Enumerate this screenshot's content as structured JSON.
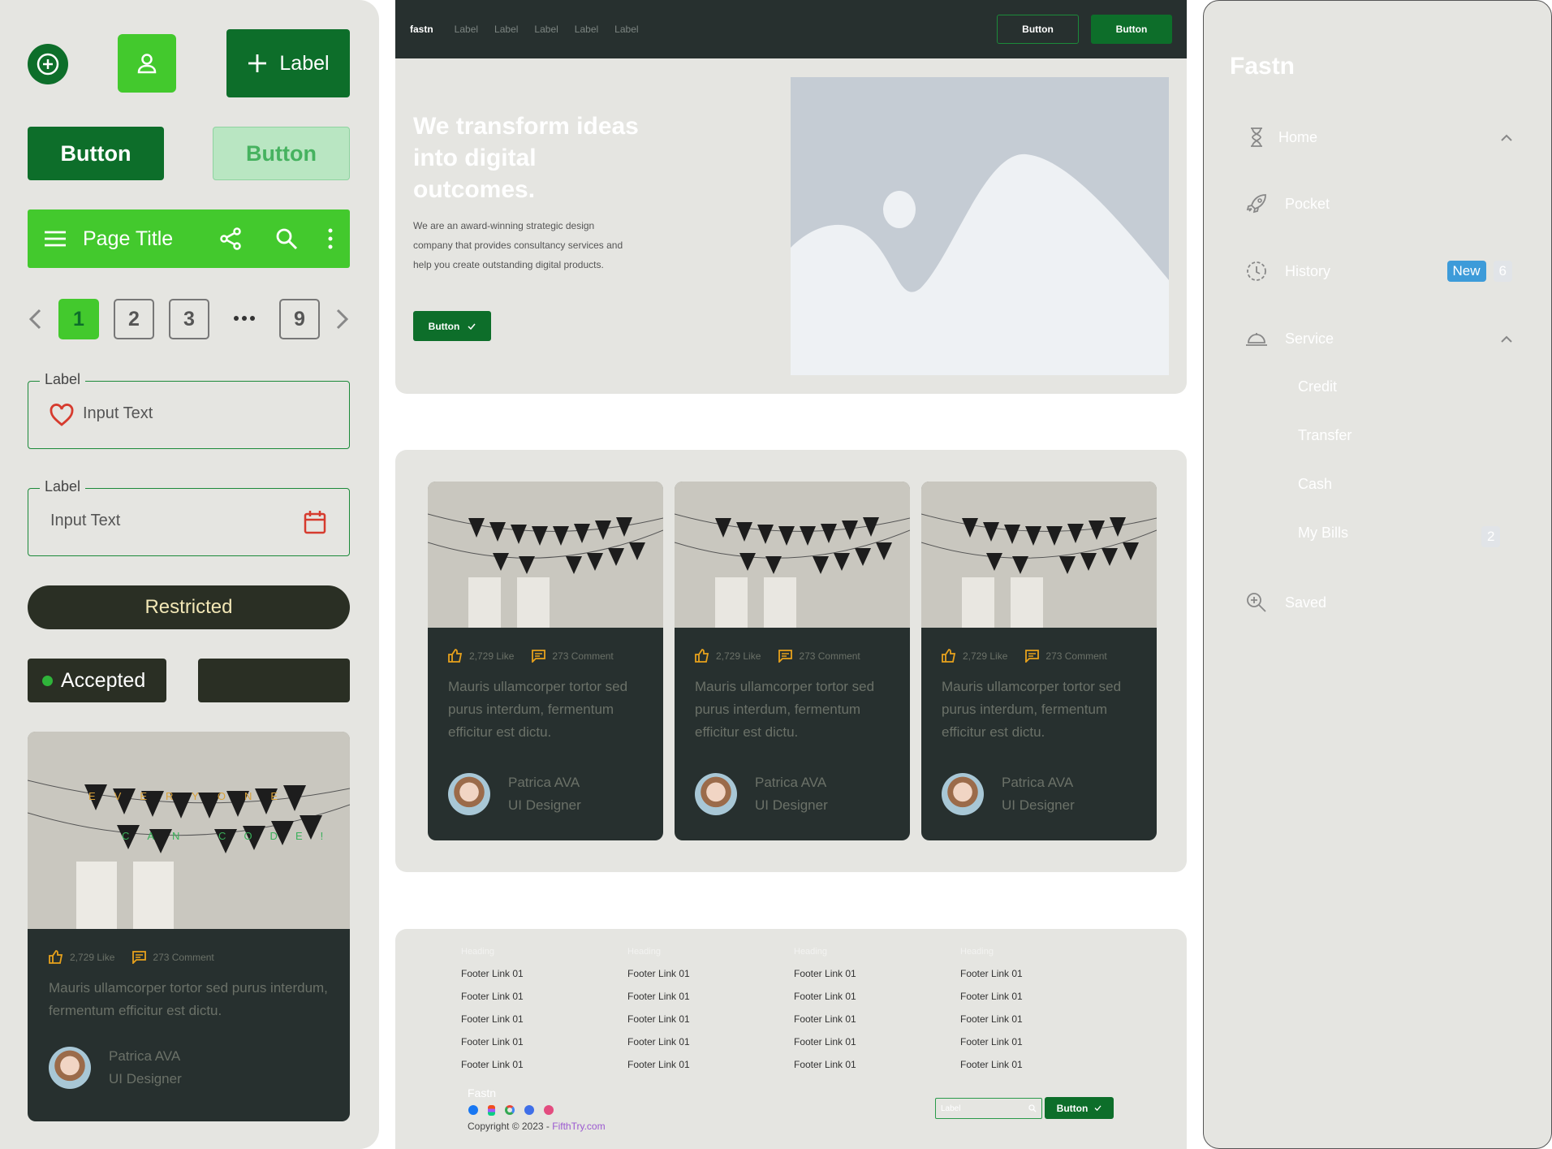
{
  "left_panel": {
    "label_button": "Label",
    "button_primary": "Button",
    "button_disabled": "Button",
    "app_bar_title": "Page Title",
    "pagination": [
      "1",
      "2",
      "3",
      "9"
    ],
    "field1": {
      "label": "Label",
      "value": "Input Text"
    },
    "field2": {
      "label": "Label",
      "value": "Input Text"
    },
    "restricted": "Restricted",
    "accepted": "Accepted",
    "card": {
      "likes": "2,729 Like",
      "comments": "273 Comment",
      "text": "Mauris ullamcorper tortor sed purus interdum, fermentum efficitur est dictu.",
      "author_name": "Patrica AVA",
      "author_role": "UI Designer",
      "banner_top": "EVERYONE",
      "banner_bottom": "CAN CODE!"
    }
  },
  "header": {
    "brand": "fastn",
    "links": [
      "Label",
      "Label",
      "Label",
      "Label",
      "Label"
    ],
    "button_outline": "Button",
    "button_solid": "Button"
  },
  "hero": {
    "title": "We transform ideas into digital outcomes.",
    "body": "We are an award-winning strategic design company that provides consultancy services and help you create outstanding digital products.",
    "button": "Button"
  },
  "cards": [
    {
      "likes": "2,729 Like",
      "comments": "273 Comment",
      "text": "Mauris ullamcorper tortor sed purus interdum, fermentum efficitur est dictu.",
      "author_name": "Patrica AVA",
      "author_role": "UI Designer"
    },
    {
      "likes": "2,729 Like",
      "comments": "273 Comment",
      "text": "Mauris ullamcorper tortor sed purus interdum, fermentum efficitur est dictu.",
      "author_name": "Patrica AVA",
      "author_role": "UI Designer"
    },
    {
      "likes": "2,729 Like",
      "comments": "273 Comment",
      "text": "Mauris ullamcorper tortor sed purus interdum, fermentum efficitur est dictu.",
      "author_name": "Patrica AVA",
      "author_role": "UI Designer"
    }
  ],
  "footer": {
    "columns": [
      {
        "heading": "Heading",
        "links": [
          "Footer Link 01",
          "Footer Link 01",
          "Footer Link 01",
          "Footer Link 01",
          "Footer Link 01"
        ]
      },
      {
        "heading": "Heading",
        "links": [
          "Footer Link 01",
          "Footer Link 01",
          "Footer Link 01",
          "Footer Link 01",
          "Footer Link 01"
        ]
      },
      {
        "heading": "Heading",
        "links": [
          "Footer Link 01",
          "Footer Link 01",
          "Footer Link 01",
          "Footer Link 01",
          "Footer Link 01"
        ]
      },
      {
        "heading": "Heading",
        "links": [
          "Footer Link 01",
          "Footer Link 01",
          "Footer Link 01",
          "Footer Link 01",
          "Footer Link 01"
        ]
      }
    ],
    "brand": "Fastn",
    "copyright": "Copyright © 2023 - ",
    "copyright_link": "FifthTry.com",
    "search_placeholder": "Label",
    "button": "Button"
  },
  "sidebar": {
    "brand": "Fastn",
    "items": [
      {
        "label": "Home",
        "icon": "hourglass-icon"
      },
      {
        "label": "Pocket",
        "icon": "rocket-icon"
      },
      {
        "label": "History",
        "icon": "clock-icon",
        "badge_new": "New",
        "badge_count": "6"
      },
      {
        "label": "Service",
        "icon": "service-bell-icon"
      },
      {
        "label": "Saved",
        "icon": "zoom-in-icon"
      }
    ],
    "sub_items": [
      "Credit",
      "Transfer",
      "Cash",
      "My Bills"
    ],
    "my_bills_badge": "2"
  },
  "colors": {
    "dark_green": "#0d6e2a",
    "bright_green": "#43c92d",
    "panel_bg": "#e5e5e1",
    "card_dark": "#27302f",
    "badge_blue": "#3d9bd9"
  }
}
